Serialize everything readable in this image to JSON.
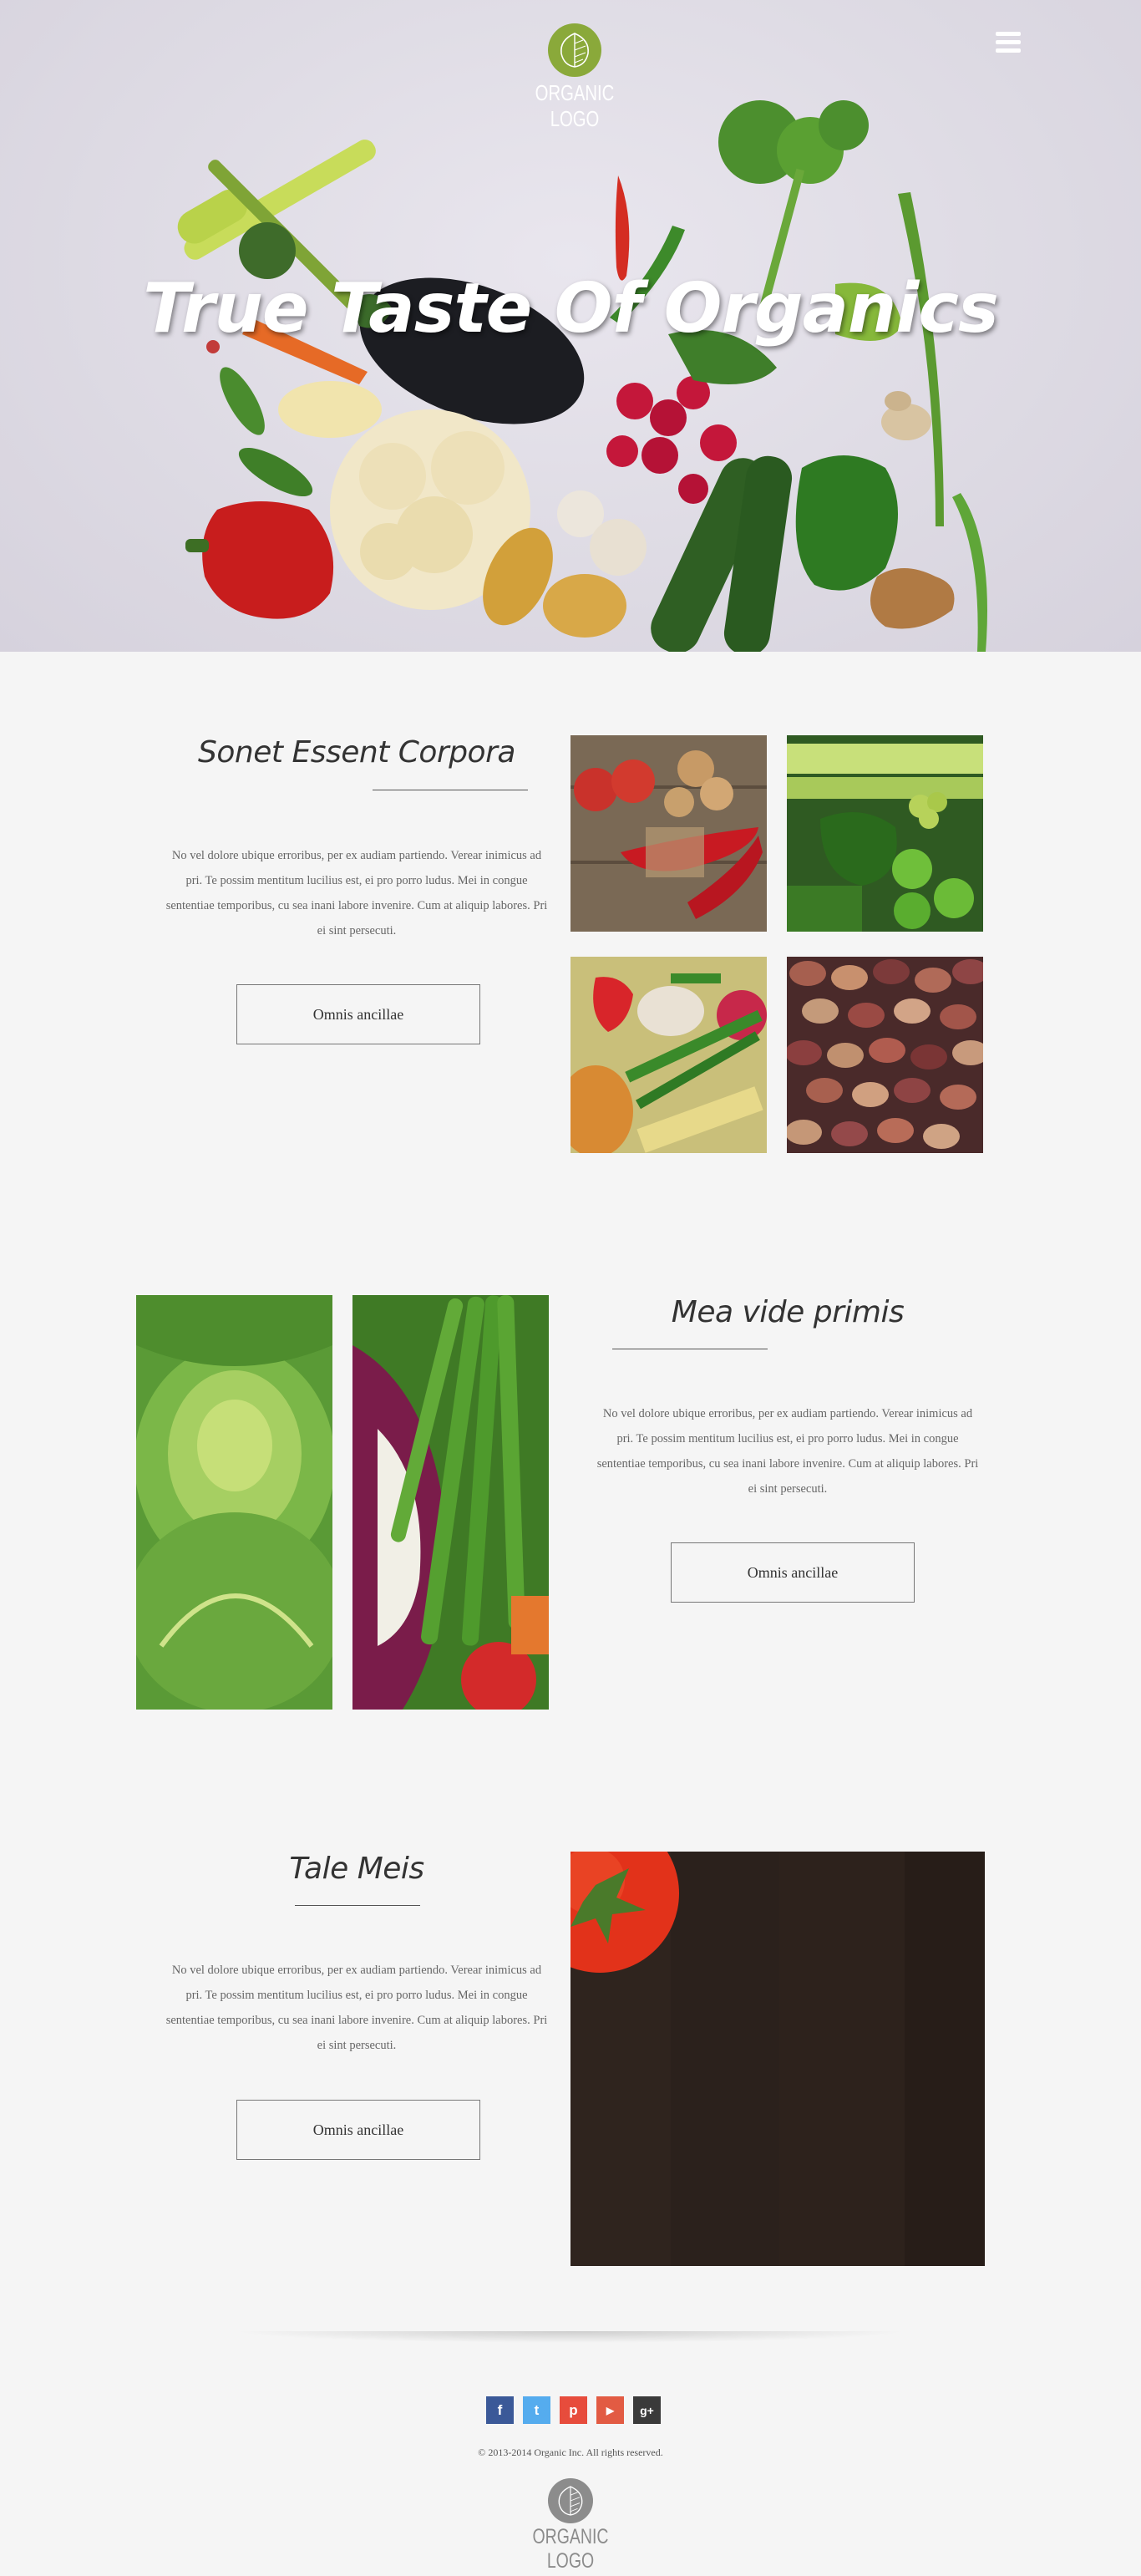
{
  "header": {
    "logo_text": "ORGANIC LOGO",
    "menu_icon": "hamburger-menu-icon",
    "hero_title": "True Taste Of Organics"
  },
  "sections": [
    {
      "title": "Sonet Essent Corpora",
      "body": "No vel dolore ubique erroribus, per ex audiam partiendo. Verear inimicus ad pri. Te possim mentitum lucilius est, ei pro porro ludus. Mei in congue sententiae temporibus, cu sea inani labore invenire. Cum at aliquip labores. Pri ei sint persecuti.",
      "button_label": "Omnis ancillae"
    },
    {
      "title": "Mea vide primis",
      "body": "No vel dolore ubique erroribus, per ex audiam partiendo. Verear inimicus ad pri. Te possim mentitum lucilius est, ei pro porro ludus. Mei in congue sententiae temporibus, cu sea inani labore invenire. Cum at aliquip labores. Pri ei sint persecuti.",
      "button_label": "Omnis ancillae"
    },
    {
      "title": "Tale Meis",
      "body": "No vel dolore ubique erroribus, per ex audiam partiendo. Verear inimicus ad pri. Te possim mentitum lucilius est, ei pro porro ludus. Mei in congue sententiae temporibus, cu sea inani labore invenire. Cum at aliquip labores. Pri ei sint persecuti.",
      "button_label": "Omnis ancillae"
    }
  ],
  "footer": {
    "social": [
      {
        "icon": "facebook-icon",
        "glyph": "f",
        "color": "#3b5998"
      },
      {
        "icon": "twitter-icon",
        "glyph": "t",
        "color": "#55acee"
      },
      {
        "icon": "pinterest-icon",
        "glyph": "p",
        "color": "#e74c3c"
      },
      {
        "icon": "youtube-icon",
        "glyph": "▶",
        "color": "#e25b43"
      },
      {
        "icon": "google-plus-icon",
        "glyph": "g+",
        "color": "#3a3a3a"
      }
    ],
    "copyright": "© 2013-2014 Organic Inc. All rights reserved.",
    "logo_text": "ORGANIC LOGO"
  },
  "colors": {
    "brand_green": "#8aa93a",
    "background": "#f5f5f5",
    "hero_background": "#dedbe4"
  }
}
